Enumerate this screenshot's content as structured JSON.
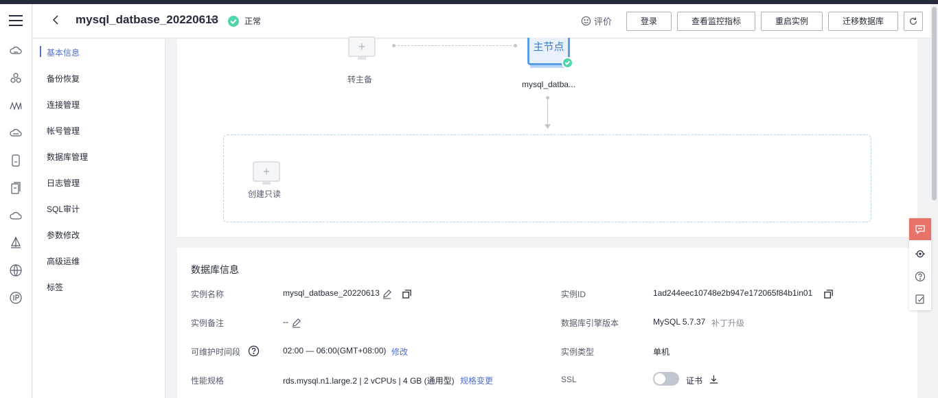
{
  "header": {
    "instance_name": "mysql_datbase_20220613",
    "status": "正常",
    "rate_label": "评价",
    "buttons": {
      "login": "登录",
      "monitor": "查看监控指标",
      "restart": "重启实例",
      "migrate": "迁移数据库"
    }
  },
  "sidenav": {
    "items": [
      {
        "label": "基本信息"
      },
      {
        "label": "备份恢复"
      },
      {
        "label": "连接管理"
      },
      {
        "label": "帐号管理"
      },
      {
        "label": "数据库管理"
      },
      {
        "label": "日志管理"
      },
      {
        "label": "SQL审计"
      },
      {
        "label": "参数修改"
      },
      {
        "label": "高级运维"
      },
      {
        "label": "标签"
      }
    ]
  },
  "topology": {
    "standby_label": "转主备",
    "master_text": "主节点",
    "master_name": "mysql_datba...",
    "readonly_label": "创建只读"
  },
  "db_info": {
    "title": "数据库信息",
    "instance_name_label": "实例名称",
    "instance_name_value": "mysql_datbase_20220613",
    "instance_id_label": "实例ID",
    "instance_id_value": "1ad244eec10748e2b947e172065f84b1in01",
    "remark_label": "实例备注",
    "remark_value": "--",
    "engine_label": "数据库引擎版本",
    "engine_value": "MySQL 5.7.37",
    "engine_action": "补丁升级",
    "maintenance_label": "可维护时间段",
    "maintenance_value": "02:00 — 06:00(GMT+08:00)",
    "maintenance_action": "修改",
    "type_label": "实例类型",
    "type_value": "单机",
    "spec_label": "性能规格",
    "spec_value": "rds.mysql.n1.large.2 | 2 vCPUs | 4 GB (通用型)",
    "spec_action": "规格变更",
    "ssl_label": "SSL",
    "ssl_enabled": false,
    "cert_label": "证书"
  }
}
